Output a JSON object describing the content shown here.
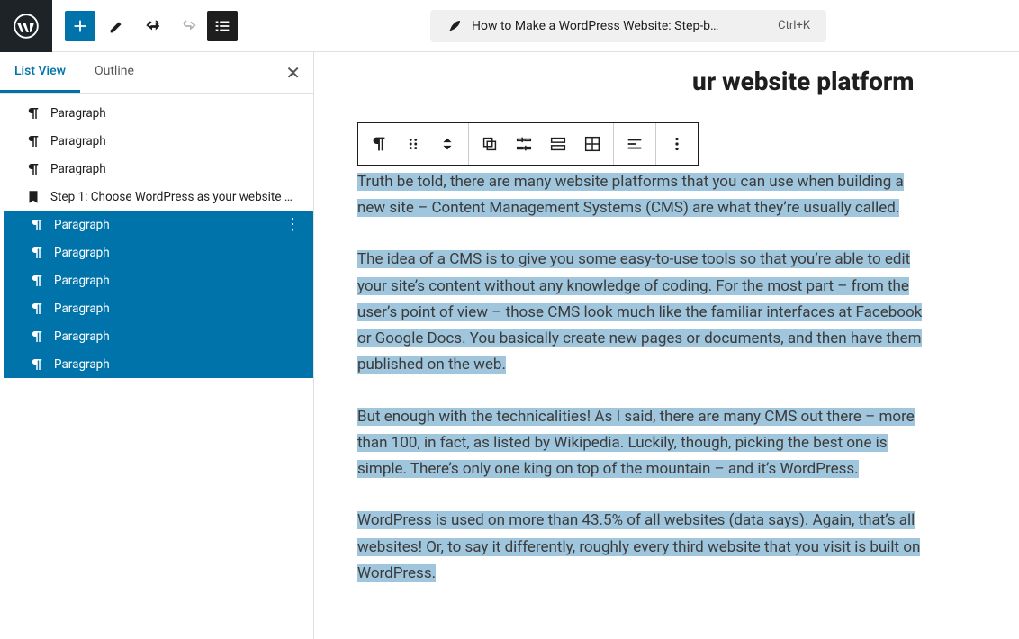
{
  "toolbar": {
    "logo_alt": "WordPress",
    "doc_title": "How to Make a WordPress Website: Step-b…",
    "shortcut": "Ctrl+K"
  },
  "sidebar": {
    "tabs": {
      "list": "List View",
      "outline": "Outline"
    },
    "items": [
      {
        "icon": "paragraph",
        "label": "Paragraph",
        "selected": false
      },
      {
        "icon": "paragraph",
        "label": "Paragraph",
        "selected": false
      },
      {
        "icon": "paragraph",
        "label": "Paragraph",
        "selected": false
      },
      {
        "icon": "heading",
        "label": "Step 1: Choose WordPress as your website …",
        "selected": false
      },
      {
        "icon": "paragraph",
        "label": "Paragraph",
        "selected": true,
        "first": true,
        "more": true
      },
      {
        "icon": "paragraph",
        "label": "Paragraph",
        "selected": true
      },
      {
        "icon": "paragraph",
        "label": "Paragraph",
        "selected": true
      },
      {
        "icon": "paragraph",
        "label": "Paragraph",
        "selected": true
      },
      {
        "icon": "paragraph",
        "label": "Paragraph",
        "selected": true
      },
      {
        "icon": "paragraph",
        "label": "Paragraph",
        "selected": true
      }
    ]
  },
  "editor": {
    "heading_suffix": "ur website platform",
    "paragraphs": [
      "Truth be told, there are many website platforms that you can use when building a new site – Content Management Systems (CMS) are what they’re usually called.",
      "The idea of a CMS is to give you some easy-to-use tools so that you’re able to edit your site’s content without any knowledge of coding. For the most part – from the user’s point of view – those CMS look much like the familiar interfaces at Facebook or Google Docs. You basically create new pages or documents, and then have them published on the web.",
      "But enough with the technicalities! As I said, there are many CMS out there – more than 100, in fact, as listed by Wikipedia. Luckily, though, picking the best one is simple. There’s only one king on top of the mountain – and it’s WordPress.",
      "WordPress is used on more than 43.5% of all websites (data says). Again, that’s all websites! Or, to say it differently, roughly every third website that you visit is built on WordPress."
    ]
  }
}
